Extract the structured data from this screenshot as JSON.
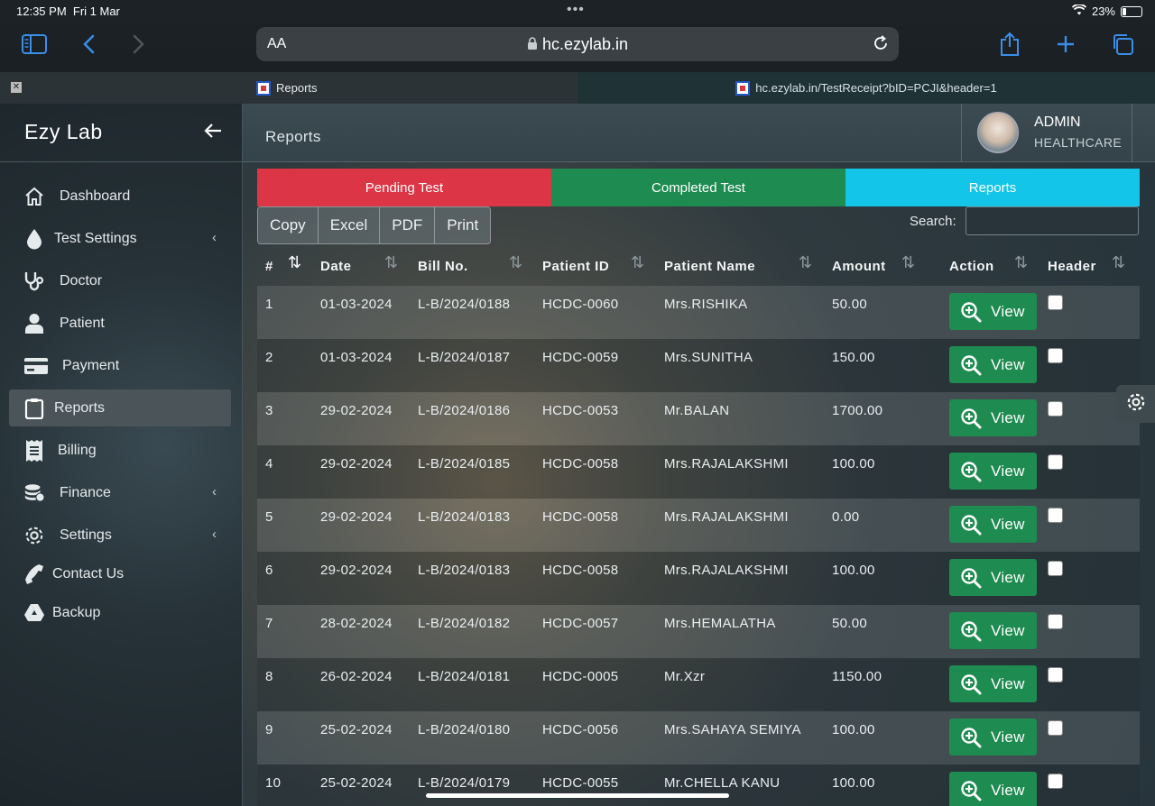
{
  "status_bar": {
    "time": "12:35 PM",
    "date": "Fri 1 Mar",
    "battery": "23%"
  },
  "browser": {
    "aa_label": "AA",
    "url": "hc.ezylab.in",
    "tabs": [
      {
        "label": "Reports"
      },
      {
        "label": "hc.ezylab.in/TestReceipt?bID=PCJI&header=1"
      }
    ]
  },
  "sidebar": {
    "brand": "Ezy Lab",
    "items": [
      {
        "label": "Dashboard",
        "icon": "home-icon"
      },
      {
        "label": "Test Settings",
        "icon": "drop-icon",
        "has_submenu": true
      },
      {
        "label": "Doctor",
        "icon": "stethoscope-icon"
      },
      {
        "label": "Patient",
        "icon": "user-icon"
      },
      {
        "label": "Payment",
        "icon": "credit-card-icon"
      },
      {
        "label": "Reports",
        "icon": "clipboard-icon",
        "active": true
      },
      {
        "label": "Billing",
        "icon": "receipt-icon"
      },
      {
        "label": "Finance",
        "icon": "coins-icon",
        "has_submenu": true
      },
      {
        "label": "Settings",
        "icon": "gear-icon",
        "has_submenu": true
      },
      {
        "label": "Contact Us",
        "icon": "phone-icon"
      },
      {
        "label": "Backup",
        "icon": "drive-icon"
      }
    ]
  },
  "header": {
    "title": "Reports",
    "user_name": "ADMIN",
    "user_org": "HEALTHCARE"
  },
  "tabs": {
    "pending": "Pending Test",
    "completed": "Completed Test",
    "reports": "Reports"
  },
  "colors": {
    "pending": "#dc3545",
    "completed": "#1e8b50",
    "reports": "#13c5e8",
    "view_button": "#1e8b50"
  },
  "export": {
    "copy": "Copy",
    "excel": "Excel",
    "pdf": "PDF",
    "print": "Print"
  },
  "search": {
    "label": "Search:",
    "value": ""
  },
  "table": {
    "columns": [
      "#",
      "Date",
      "Bill No.",
      "Patient ID",
      "Patient Name",
      "Amount",
      "Action",
      "Header"
    ],
    "view_label": "View",
    "rows": [
      {
        "no": "1",
        "date": "01-03-2024",
        "bill": "L-B/2024/0188",
        "pid": "HCDC-0060",
        "name": "Mrs.RISHIKA",
        "amount": "50.00"
      },
      {
        "no": "2",
        "date": "01-03-2024",
        "bill": "L-B/2024/0187",
        "pid": "HCDC-0059",
        "name": "Mrs.SUNITHA",
        "amount": "150.00"
      },
      {
        "no": "3",
        "date": "29-02-2024",
        "bill": "L-B/2024/0186",
        "pid": "HCDC-0053",
        "name": "Mr.BALAN",
        "amount": "1700.00"
      },
      {
        "no": "4",
        "date": "29-02-2024",
        "bill": "L-B/2024/0185",
        "pid": "HCDC-0058",
        "name": "Mrs.RAJALAKSHMI",
        "amount": "100.00"
      },
      {
        "no": "5",
        "date": "29-02-2024",
        "bill": "L-B/2024/0183",
        "pid": "HCDC-0058",
        "name": "Mrs.RAJALAKSHMI",
        "amount": "0.00"
      },
      {
        "no": "6",
        "date": "29-02-2024",
        "bill": "L-B/2024/0183",
        "pid": "HCDC-0058",
        "name": "Mrs.RAJALAKSHMI",
        "amount": "100.00"
      },
      {
        "no": "7",
        "date": "28-02-2024",
        "bill": "L-B/2024/0182",
        "pid": "HCDC-0057",
        "name": "Mrs.HEMALATHA",
        "amount": "50.00"
      },
      {
        "no": "8",
        "date": "26-02-2024",
        "bill": "L-B/2024/0181",
        "pid": "HCDC-0005",
        "name": "Mr.Xzr",
        "amount": "1150.00"
      },
      {
        "no": "9",
        "date": "25-02-2024",
        "bill": "L-B/2024/0180",
        "pid": "HCDC-0056",
        "name": "Mrs.SAHAYA SEMIYA",
        "amount": "100.00"
      },
      {
        "no": "10",
        "date": "25-02-2024",
        "bill": "L-B/2024/0179",
        "pid": "HCDC-0055",
        "name": "Mr.CHELLA KANU",
        "amount": "100.00"
      }
    ]
  }
}
